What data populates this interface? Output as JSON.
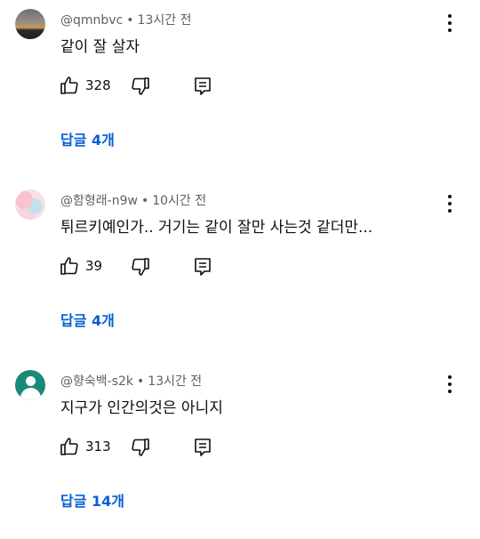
{
  "comments": [
    {
      "author": "@qmnbvc",
      "time": "13시간 전",
      "separator": "•",
      "text": "같이 잘 살자",
      "likes": "328",
      "replies": "답글 4개",
      "avatar": "sunset-photo"
    },
    {
      "author": "@함형래-n9w",
      "time": "10시간 전",
      "separator": "•",
      "text": "튀르키예인가.. 거기는 같이 잘만 사는것 같더만...",
      "likes": "39",
      "replies": "답글 4개",
      "avatar": "pastel-illustration"
    },
    {
      "author": "@향숙백-s2k",
      "time": "13시간 전",
      "separator": "•",
      "text": "지구가  인간의것은 아니지",
      "likes": "313",
      "replies": "답글 14개",
      "avatar": "default-person"
    }
  ],
  "icons": {
    "like": "thumbs-up-icon",
    "dislike": "thumbs-down-icon",
    "reply": "reply-comment-icon",
    "menu": "more-vertical-icon"
  },
  "colors": {
    "link": "#065fd4",
    "meta": "#606060",
    "text": "#0f0f0f",
    "default_avatar": "#1a8a78"
  }
}
